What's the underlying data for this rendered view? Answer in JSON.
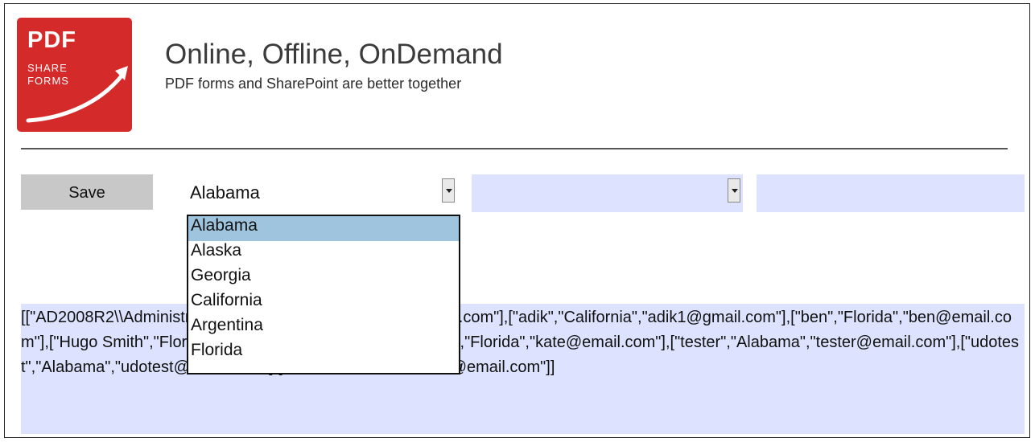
{
  "brand": {
    "logo_line_top": "PDF",
    "logo_line_mid": "SHARE",
    "logo_line_bottom": "FORMS",
    "accent": "#d42a2a"
  },
  "header": {
    "title": "Online, Offline, OnDemand",
    "subtitle": "PDF forms and SharePoint are better together"
  },
  "toolbar": {
    "save_label": "Save"
  },
  "state_select": {
    "value": "Alabama",
    "options": [
      "Alabama",
      "Alaska",
      "Georgia",
      "California",
      "Argentina",
      "Florida"
    ],
    "highlighted": "Alabama"
  },
  "second_select": {
    "value": ""
  },
  "third_field": {
    "value": ""
  },
  "output": {
    "text": "[[\"AD2008R2\\\\Administrator\",\"Florida\",\"James.Sullivan@pdfsf.com\"],[\"adik\",\"California\",\"adik1@gmail.com\"],[\"ben\",\"Florida\",\"ben@email.com\"],[\"Hugo Smith\",\"Florida\",\"hugo@email.com\"],[\"Kate Arden\",\"Florida\",\"kate@email.com\"],[\"tester\",\"Alabama\",\"tester@email.com\"],[\"udotest\",\"Alabama\",\"udotest@email.com\"],[\"user\",\"California\",\"user@email.com\"]]"
  },
  "colors": {
    "field_bg": "#dde3ff",
    "option_highlight": "#9fc4de",
    "button_bg": "#c8c8c8"
  }
}
